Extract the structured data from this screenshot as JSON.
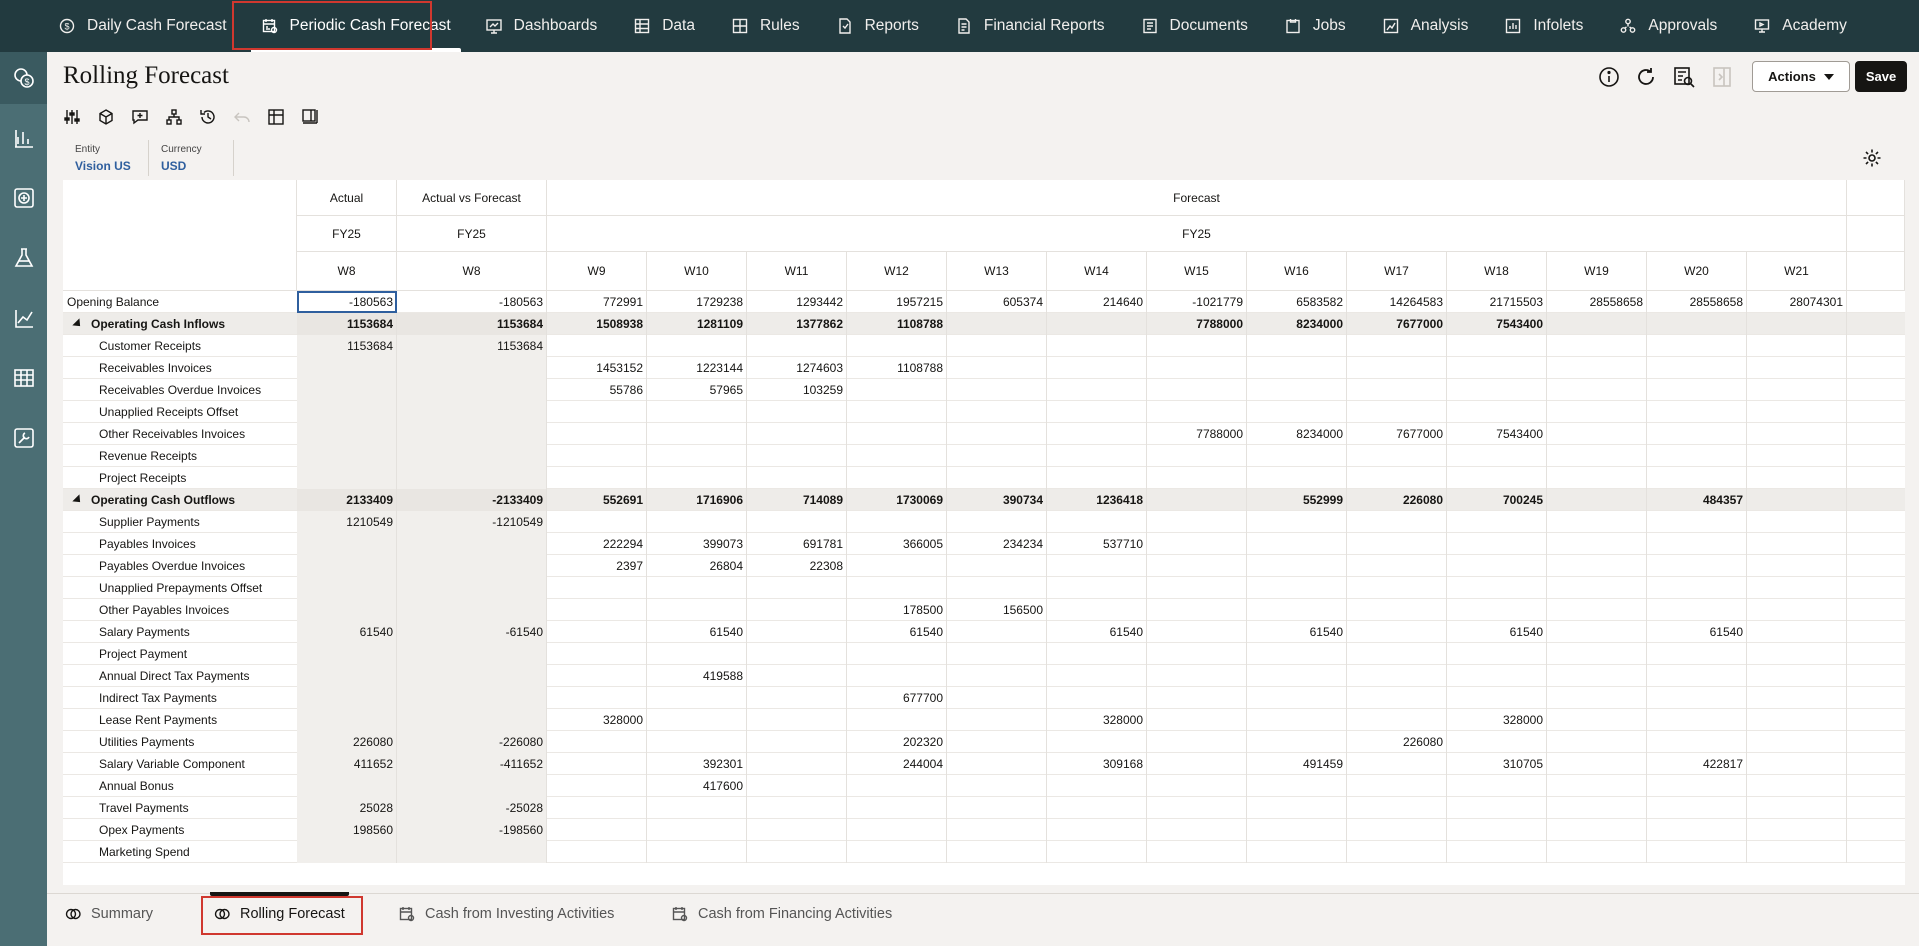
{
  "nav": {
    "tabs": [
      {
        "label": "Daily Cash Forecast",
        "icon": "dollar-cycle-icon"
      },
      {
        "label": "Periodic Cash Forecast",
        "icon": "calendar-report-icon",
        "active": true
      },
      {
        "label": "Dashboards",
        "icon": "dashboard-icon"
      },
      {
        "label": "Data",
        "icon": "data-grid-icon"
      },
      {
        "label": "Rules",
        "icon": "rules-icon"
      },
      {
        "label": "Reports",
        "icon": "reports-icon"
      },
      {
        "label": "Financial Reports",
        "icon": "financial-reports-icon"
      },
      {
        "label": "Documents",
        "icon": "documents-icon"
      },
      {
        "label": "Jobs",
        "icon": "jobs-icon"
      },
      {
        "label": "Analysis",
        "icon": "analysis-icon"
      },
      {
        "label": "Infolets",
        "icon": "infolets-icon"
      },
      {
        "label": "Approvals",
        "icon": "approvals-icon"
      },
      {
        "label": "Academy",
        "icon": "academy-icon"
      }
    ]
  },
  "page": {
    "title": "Rolling Forecast",
    "actions_label": "Actions",
    "save_label": "Save"
  },
  "pov": [
    {
      "label": "Entity",
      "value": "Vision US"
    },
    {
      "label": "Currency",
      "value": "USD"
    }
  ],
  "grid": {
    "scenario_headers": [
      "Actual",
      "Actual vs Forecast",
      "Forecast"
    ],
    "year_headers": [
      "FY25",
      "FY25",
      "FY25"
    ],
    "week_headers": [
      "W8",
      "W8",
      "W9",
      "W10",
      "W11",
      "W12",
      "W13",
      "W14",
      "W15",
      "W16",
      "W17",
      "W18",
      "W19",
      "W20",
      "W21"
    ],
    "rows": [
      {
        "label": "Opening Balance",
        "level": 0,
        "group": false,
        "cells": [
          "-180563",
          "-180563",
          "772991",
          "1729238",
          "1293442",
          "1957215",
          "605374",
          "214640",
          "-1021779",
          "6583582",
          "14264583",
          "21715503",
          "28558658",
          "28558658",
          "28074301"
        ]
      },
      {
        "label": "Operating Cash Inflows",
        "level": 0,
        "group": true,
        "cells": [
          "1153684",
          "1153684",
          "1508938",
          "1281109",
          "1377862",
          "1108788",
          "",
          "",
          "7788000",
          "8234000",
          "7677000",
          "7543400",
          "",
          "",
          ""
        ]
      },
      {
        "label": "Customer Receipts",
        "level": 1,
        "group": false,
        "cells": [
          "1153684",
          "1153684",
          "",
          "",
          "",
          "",
          "",
          "",
          "",
          "",
          "",
          "",
          "",
          "",
          ""
        ]
      },
      {
        "label": "Receivables Invoices",
        "level": 1,
        "group": false,
        "cells": [
          "",
          "",
          "1453152",
          "1223144",
          "1274603",
          "1108788",
          "",
          "",
          "",
          "",
          "",
          "",
          "",
          "",
          ""
        ]
      },
      {
        "label": "Receivables Overdue Invoices",
        "level": 1,
        "group": false,
        "cells": [
          "",
          "",
          "55786",
          "57965",
          "103259",
          "",
          "",
          "",
          "",
          "",
          "",
          "",
          "",
          "",
          ""
        ]
      },
      {
        "label": "Unapplied Receipts Offset",
        "level": 1,
        "group": false,
        "cells": [
          "",
          "",
          "",
          "",
          "",
          "",
          "",
          "",
          "",
          "",
          "",
          "",
          "",
          "",
          ""
        ]
      },
      {
        "label": "Other Receivables Invoices",
        "level": 1,
        "group": false,
        "cells": [
          "",
          "",
          "",
          "",
          "",
          "",
          "",
          "",
          "7788000",
          "8234000",
          "7677000",
          "7543400",
          "",
          "",
          ""
        ]
      },
      {
        "label": "Revenue Receipts",
        "level": 1,
        "group": false,
        "cells": [
          "",
          "",
          "",
          "",
          "",
          "",
          "",
          "",
          "",
          "",
          "",
          "",
          "",
          "",
          ""
        ]
      },
      {
        "label": "Project Receipts",
        "level": 1,
        "group": false,
        "cells": [
          "",
          "",
          "",
          "",
          "",
          "",
          "",
          "",
          "",
          "",
          "",
          "",
          "",
          "",
          ""
        ]
      },
      {
        "label": "Operating Cash Outflows",
        "level": 0,
        "group": true,
        "cells": [
          "2133409",
          "-2133409",
          "552691",
          "1716906",
          "714089",
          "1730069",
          "390734",
          "1236418",
          "",
          "552999",
          "226080",
          "700245",
          "",
          "484357",
          ""
        ]
      },
      {
        "label": "Supplier Payments",
        "level": 1,
        "group": false,
        "cells": [
          "1210549",
          "-1210549",
          "",
          "",
          "",
          "",
          "",
          "",
          "",
          "",
          "",
          "",
          "",
          "",
          ""
        ]
      },
      {
        "label": "Payables Invoices",
        "level": 1,
        "group": false,
        "cells": [
          "",
          "",
          "222294",
          "399073",
          "691781",
          "366005",
          "234234",
          "537710",
          "",
          "",
          "",
          "",
          "",
          "",
          ""
        ]
      },
      {
        "label": "Payables Overdue Invoices",
        "level": 1,
        "group": false,
        "cells": [
          "",
          "",
          "2397",
          "26804",
          "22308",
          "",
          "",
          "",
          "",
          "",
          "",
          "",
          "",
          "",
          ""
        ]
      },
      {
        "label": "Unapplied Prepayments Offset",
        "level": 1,
        "group": false,
        "cells": [
          "",
          "",
          "",
          "",
          "",
          "",
          "",
          "",
          "",
          "",
          "",
          "",
          "",
          "",
          ""
        ]
      },
      {
        "label": "Other Payables Invoices",
        "level": 1,
        "group": false,
        "cells": [
          "",
          "",
          "",
          "",
          "",
          "178500",
          "156500",
          "",
          "",
          "",
          "",
          "",
          "",
          "",
          ""
        ]
      },
      {
        "label": "Salary Payments",
        "level": 1,
        "group": false,
        "cells": [
          "61540",
          "-61540",
          "",
          "61540",
          "",
          "61540",
          "",
          "61540",
          "",
          "61540",
          "",
          "61540",
          "",
          "61540",
          ""
        ]
      },
      {
        "label": "Project Payment",
        "level": 1,
        "group": false,
        "cells": [
          "",
          "",
          "",
          "",
          "",
          "",
          "",
          "",
          "",
          "",
          "",
          "",
          "",
          "",
          ""
        ]
      },
      {
        "label": "Annual Direct Tax Payments",
        "level": 1,
        "group": false,
        "cells": [
          "",
          "",
          "",
          "419588",
          "",
          "",
          "",
          "",
          "",
          "",
          "",
          "",
          "",
          "",
          ""
        ]
      },
      {
        "label": "Indirect Tax Payments",
        "level": 1,
        "group": false,
        "cells": [
          "",
          "",
          "",
          "",
          "",
          "677700",
          "",
          "",
          "",
          "",
          "",
          "",
          "",
          "",
          ""
        ]
      },
      {
        "label": "Lease Rent Payments",
        "level": 1,
        "group": false,
        "cells": [
          "",
          "",
          "328000",
          "",
          "",
          "",
          "",
          "328000",
          "",
          "",
          "",
          "328000",
          "",
          "",
          ""
        ]
      },
      {
        "label": "Utilities Payments",
        "level": 1,
        "group": false,
        "cells": [
          "226080",
          "-226080",
          "",
          "",
          "",
          "202320",
          "",
          "",
          "",
          "",
          "226080",
          "",
          "",
          "",
          ""
        ]
      },
      {
        "label": "Salary Variable Component",
        "level": 1,
        "group": false,
        "cells": [
          "411652",
          "-411652",
          "",
          "392301",
          "",
          "244004",
          "",
          "309168",
          "",
          "491459",
          "",
          "310705",
          "",
          "422817",
          ""
        ]
      },
      {
        "label": "Annual Bonus",
        "level": 1,
        "group": false,
        "cells": [
          "",
          "",
          "",
          "417600",
          "",
          "",
          "",
          "",
          "",
          "",
          "",
          "",
          "",
          "",
          ""
        ]
      },
      {
        "label": "Travel Payments",
        "level": 1,
        "group": false,
        "cells": [
          "25028",
          "-25028",
          "",
          "",
          "",
          "",
          "",
          "",
          "",
          "",
          "",
          "",
          "",
          "",
          ""
        ]
      },
      {
        "label": "Opex Payments",
        "level": 1,
        "group": false,
        "cells": [
          "198560",
          "-198560",
          "",
          "",
          "",
          "",
          "",
          "",
          "",
          "",
          "",
          "",
          "",
          "",
          ""
        ]
      },
      {
        "label": "Marketing Spend",
        "level": 1,
        "group": false,
        "cells": [
          "",
          "",
          "",
          "",
          "",
          "",
          "",
          "",
          "",
          "",
          "",
          "",
          "",
          "",
          ""
        ]
      }
    ]
  },
  "bottom_tabs": [
    {
      "label": "Summary",
      "icon": "summary-icon"
    },
    {
      "label": "Rolling Forecast",
      "icon": "rolling-forecast-icon",
      "active": true
    },
    {
      "label": "Cash from Investing Activities",
      "icon": "investing-icon"
    },
    {
      "label": "Cash from Financing Activities",
      "icon": "financing-icon"
    }
  ],
  "colors": {
    "nav_bg": "#223a3f",
    "rail_bg": "#4b6e74",
    "highlight": "#d0382f",
    "link": "#2f5f9e"
  }
}
